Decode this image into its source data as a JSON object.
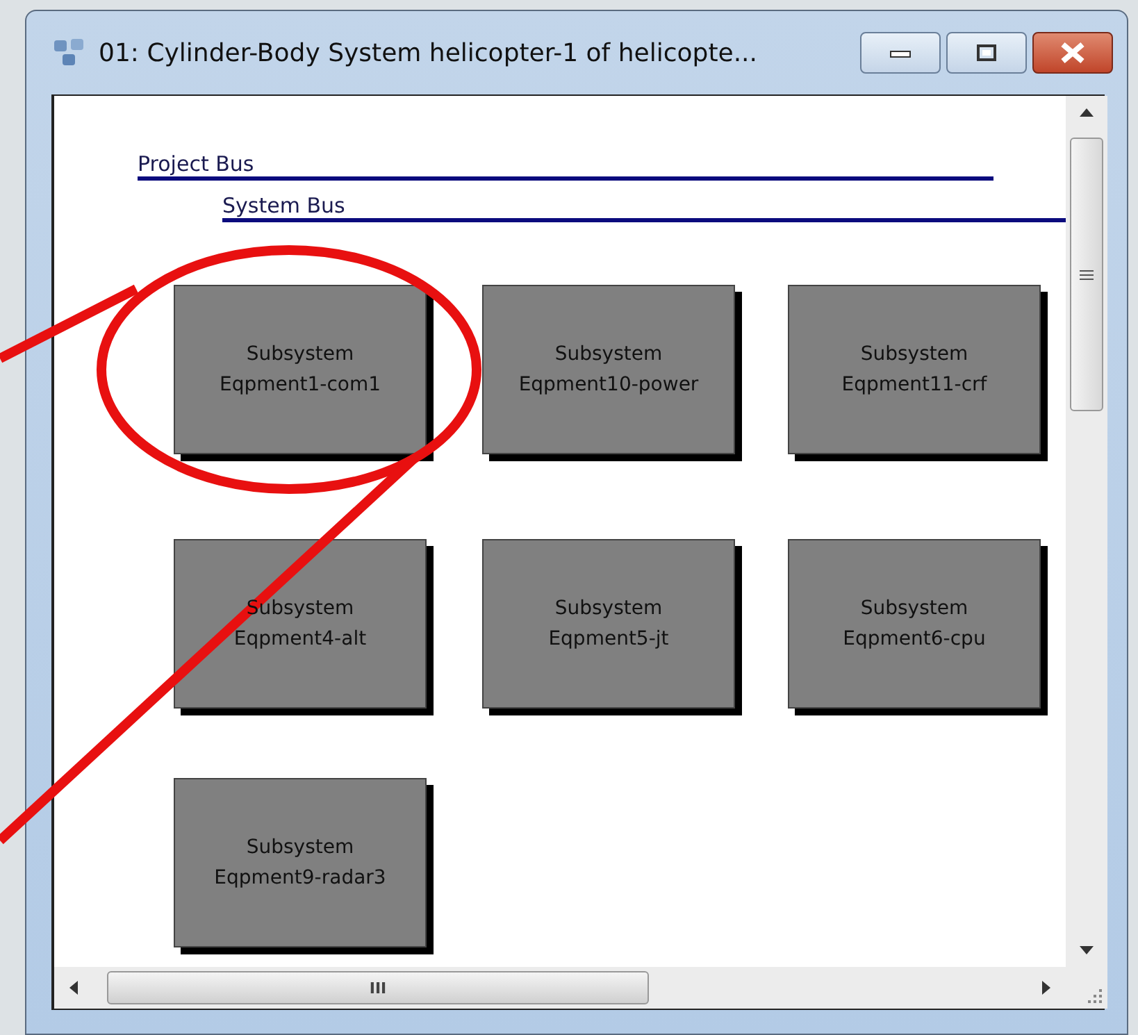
{
  "window": {
    "title": "01: Cylinder-Body System helicopter-1 of helicopte..."
  },
  "buses": [
    {
      "label": "Project Bus",
      "kind": "project"
    },
    {
      "label": "System Bus",
      "kind": "system"
    }
  ],
  "subsystems": [
    {
      "type": "Subsystem",
      "name": "Eqpment1-com1"
    },
    {
      "type": "Subsystem",
      "name": "Eqpment10-power"
    },
    {
      "type": "Subsystem",
      "name": "Eqpment11-crf"
    },
    {
      "type": "Subsystem",
      "name": "Eqpment4-alt"
    },
    {
      "type": "Subsystem",
      "name": "Eqpment5-jt"
    },
    {
      "type": "Subsystem",
      "name": "Eqpment6-cpu"
    },
    {
      "type": "Subsystem",
      "name": "Eqpment9-radar3"
    }
  ],
  "scrollbars": {
    "horizontal_grip": "III"
  }
}
